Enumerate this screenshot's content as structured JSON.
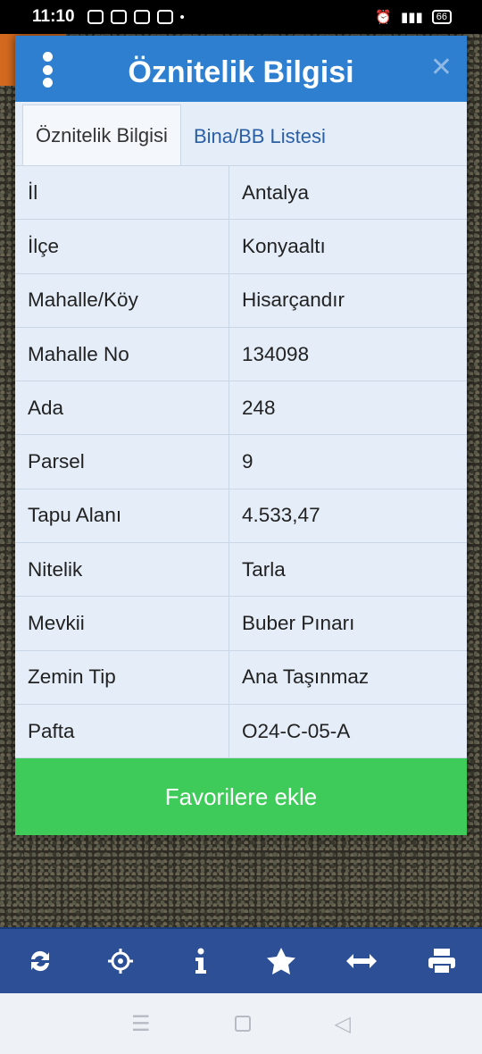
{
  "status": {
    "time": "11:10",
    "battery": "66"
  },
  "dialog": {
    "title": "Öznitelik Bilgisi",
    "tabs": [
      {
        "label": "Öznitelik Bilgisi"
      },
      {
        "label": "Bina/BB Listesi"
      }
    ],
    "rows": [
      {
        "key": "İl",
        "value": "Antalya"
      },
      {
        "key": "İlçe",
        "value": "Konyaaltı"
      },
      {
        "key": "Mahalle/Köy",
        "value": "Hisarçandır"
      },
      {
        "key": "Mahalle No",
        "value": "134098"
      },
      {
        "key": "Ada",
        "value": "248"
      },
      {
        "key": "Parsel",
        "value": "9"
      },
      {
        "key": "Tapu Alanı",
        "value": "4.533,47"
      },
      {
        "key": "Nitelik",
        "value": "Tarla"
      },
      {
        "key": "Mevkii",
        "value": "Buber Pınarı"
      },
      {
        "key": "Zemin Tip",
        "value": "Ana Taşınmaz"
      },
      {
        "key": "Pafta",
        "value": "O24-C-05-A"
      }
    ],
    "favorite_label": "Favorilere ekle"
  },
  "toolbar": {
    "icons": [
      "refresh-icon",
      "locate-icon",
      "info-icon",
      "star-icon",
      "measure-icon",
      "print-icon"
    ]
  },
  "colors": {
    "header": "#2f7fd0",
    "favorite": "#3ecb5a",
    "toolbar": "#2c4f96"
  }
}
